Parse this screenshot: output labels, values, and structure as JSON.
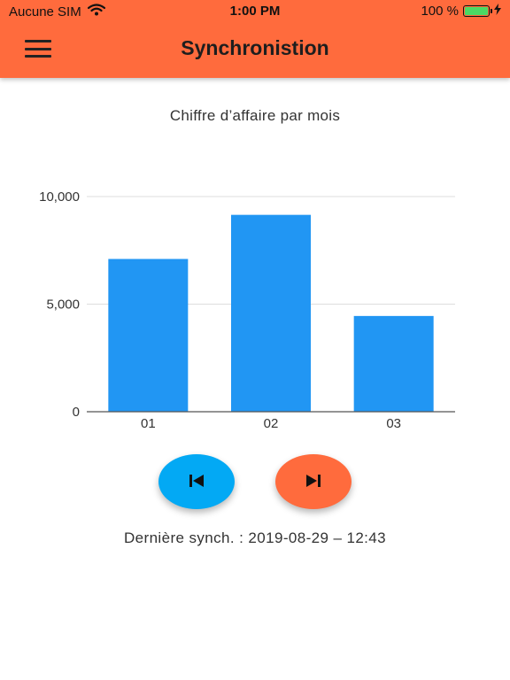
{
  "status_bar": {
    "carrier": "Aucune SIM",
    "time": "1:00 PM",
    "battery": "100 %",
    "battery_level": 1.0
  },
  "app_bar": {
    "title": "Synchronistion",
    "menu_icon": "hamburger-menu-icon",
    "background_color": "#FF6B3D"
  },
  "chart_data": {
    "type": "bar",
    "title": "Chiffre d’affaire par mois",
    "categories": [
      "01",
      "02",
      "03"
    ],
    "values": [
      7100,
      9150,
      4450
    ],
    "yticks": [
      "10,000",
      "5,000",
      "0"
    ],
    "ytick_values": [
      10000,
      5000,
      0
    ],
    "ylim": [
      0,
      10000
    ],
    "grid": true,
    "bar_color": "#2196F3"
  },
  "controls": {
    "prev_icon": "skip-previous-icon",
    "next_icon": "skip-next-icon",
    "prev_color": "#03A9F4",
    "next_color": "#FF6B3D"
  },
  "sync": {
    "text": "Dernière synch. : 2019-08-29 – 12:43"
  }
}
